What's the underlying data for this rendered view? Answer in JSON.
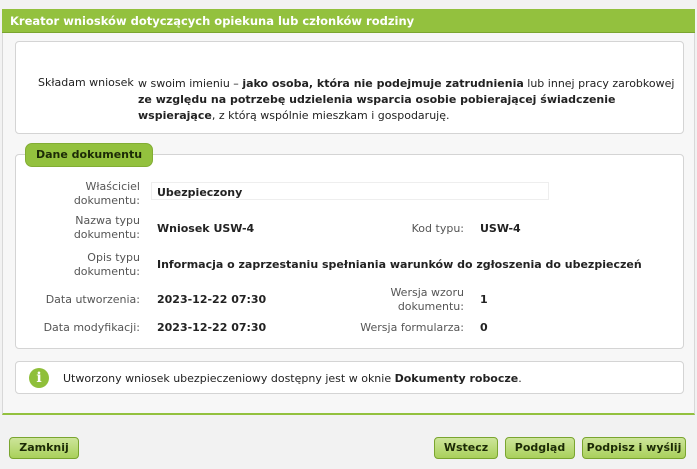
{
  "window": {
    "title": "Kreator wniosków dotyczących opiekuna lub członków rodziny"
  },
  "intro": {
    "label": "Składam wniosek",
    "text_parts": [
      {
        "text": "w swoim imieniu – ",
        "bold": false
      },
      {
        "text": "jako osoba, która nie podejmuje zatrudnienia",
        "bold": true
      },
      {
        "text": " lub innej pracy zarobkowej ",
        "bold": false
      },
      {
        "text": "ze względu na potrzebę udzielenia wsparcia osobie pobierającej świadczenie wspierające",
        "bold": true
      },
      {
        "text": ", z którą wspólnie mieszkam i gospodaruję.",
        "bold": false
      }
    ]
  },
  "document": {
    "section_title": "Dane dokumentu",
    "owner_label": "Właściciel dokumentu:",
    "owner_value": "Ubezpieczony",
    "type_name_label": "Nazwa typu dokumentu:",
    "type_name_value": "Wniosek USW-4",
    "type_code_label": "Kod typu:",
    "type_code_value": "USW-4",
    "type_desc_label": "Opis typu dokumentu:",
    "type_desc_value": "Informacja o zaprzestaniu spełniania warunków do zgłoszenia do ubezpieczeń",
    "created_label": "Data utworzenia:",
    "created_value": "2023-12-22 07:30",
    "template_version_label": "Wersja wzoru dokumentu:",
    "template_version_value": "1",
    "modified_label": "Data modyfikacji:",
    "modified_value": "2023-12-22 07:30",
    "form_version_label": "Wersja formularza:",
    "form_version_value": "0"
  },
  "info": {
    "icon": "info-icon",
    "text_before": "Utworzony wniosek ubezpieczeniowy dostępny jest w oknie ",
    "text_bold": "Dokumenty robocze",
    "text_after": "."
  },
  "buttons": {
    "close": "Zamknij",
    "back": "Wstecz",
    "preview": "Podgląd",
    "sign_send": "Podpisz i wyślij"
  },
  "colors": {
    "accent": "#93c13e",
    "button": "#a9d05b"
  }
}
